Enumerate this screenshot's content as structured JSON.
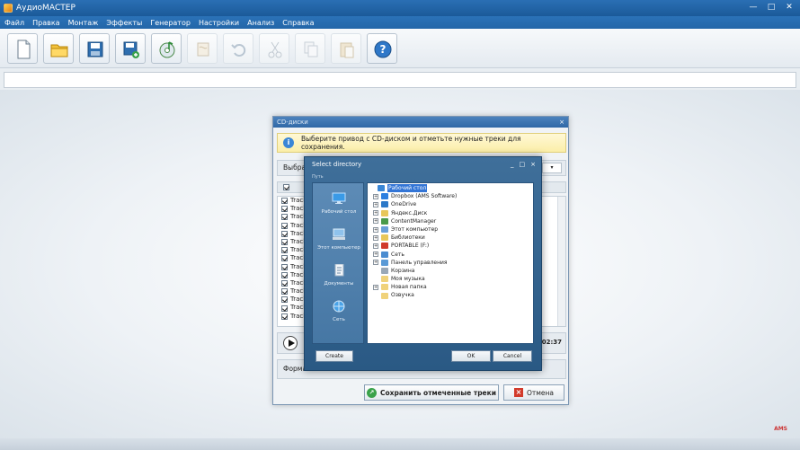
{
  "app": {
    "title": "АудиоМАСТЕР"
  },
  "menu": [
    "Файл",
    "Правка",
    "Монтаж",
    "Эффекты",
    "Генератор",
    "Настройки",
    "Анализ",
    "Справка"
  ],
  "toolbar": {
    "buttons": [
      {
        "icon": "new-file-icon",
        "enabled": true
      },
      {
        "icon": "open-folder-icon",
        "enabled": true
      },
      {
        "icon": "save-icon",
        "enabled": true
      },
      {
        "icon": "save-as-icon",
        "enabled": true
      },
      {
        "icon": "cd-music-icon",
        "enabled": true
      },
      {
        "icon": "paste-audio-icon",
        "enabled": false
      },
      {
        "icon": "undo-icon",
        "enabled": false
      },
      {
        "icon": "scissors-icon",
        "enabled": false
      },
      {
        "icon": "copy-icon",
        "enabled": false
      },
      {
        "icon": "paste-icon",
        "enabled": false
      },
      {
        "icon": "help-icon",
        "enabled": true
      }
    ]
  },
  "cd_dialog": {
    "title": "CD-диски",
    "close": "×",
    "info": "Выберите привод с CD-диском и отметьте нужные треки для сохранения.",
    "drive_label": "Выбран",
    "drive_arrow": "▾",
    "tracks": [
      "Track",
      "Track",
      "Track",
      "Track",
      "Track",
      "Track",
      "Track",
      "Track",
      "Track",
      "Track",
      "Track",
      "Track",
      "Track",
      "Track",
      "Track"
    ],
    "time": "02:37",
    "format_label": "Формат",
    "save_button": "Сохранить отмеченные треки",
    "cancel_button": "Отмена"
  },
  "dir_dialog": {
    "title": "Select directory",
    "path_label": "Путь",
    "min": "_",
    "max": "□",
    "close": "×",
    "places": [
      {
        "label": "Рабочий стол",
        "icon": "desktop-icon"
      },
      {
        "label": "Этот компьютер",
        "icon": "computer-icon"
      },
      {
        "label": "Документы",
        "icon": "documents-icon"
      },
      {
        "label": "Сеть",
        "icon": "network-icon"
      }
    ],
    "tree": [
      {
        "label": "Рабочий стол",
        "level": 0,
        "expander": "",
        "color": "#3a86d6",
        "selected": true
      },
      {
        "label": "Dropbox (AMS Software)",
        "level": 1,
        "expander": "+",
        "color": "#2d7fe0"
      },
      {
        "label": "OneDrive",
        "level": 1,
        "expander": "+",
        "color": "#2b78c8"
      },
      {
        "label": "Яндекс.Диск",
        "level": 1,
        "expander": "+",
        "color": "#e8c75a"
      },
      {
        "label": "ContentManager",
        "level": 1,
        "expander": "+",
        "color": "#4a9a4a"
      },
      {
        "label": "Этот компьютер",
        "level": 1,
        "expander": "+",
        "color": "#6aa0d8"
      },
      {
        "label": "Библиотеки",
        "level": 1,
        "expander": "+",
        "color": "#e8c75a"
      },
      {
        "label": "PORTABLE (F:)",
        "level": 1,
        "expander": "+",
        "color": "#d03a2b"
      },
      {
        "label": "Сеть",
        "level": 1,
        "expander": "+",
        "color": "#4a8cd0"
      },
      {
        "label": "Панель управления",
        "level": 1,
        "expander": "+",
        "color": "#5a9ad6"
      },
      {
        "label": "Корзина",
        "level": 1,
        "expander": "",
        "color": "#9aa8b6"
      },
      {
        "label": "Моя музыка",
        "level": 1,
        "expander": "",
        "color": "#f0d27a"
      },
      {
        "label": "Новая папка",
        "level": 1,
        "expander": "+",
        "color": "#f0d27a"
      },
      {
        "label": "Озвучка",
        "level": 1,
        "expander": "",
        "color": "#f0d27a"
      }
    ],
    "create_button": "Create",
    "ok_button": "OK",
    "cancel_button": "Cancel"
  },
  "brand": {
    "mark": "AMS"
  }
}
